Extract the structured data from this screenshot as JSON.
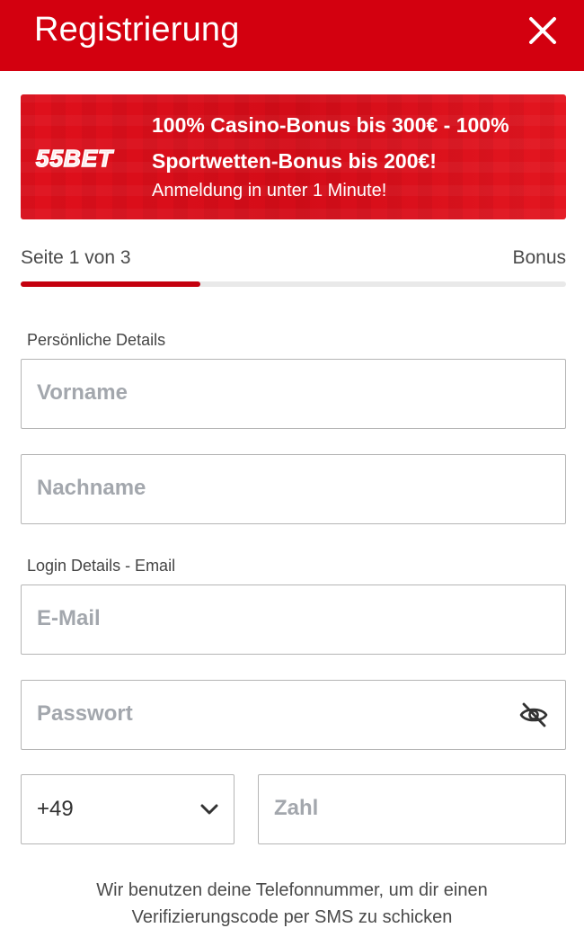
{
  "header": {
    "title": "Registrierung",
    "close_icon": "close-icon",
    "color": "#d3000f"
  },
  "banner": {
    "logo_text": "55BET",
    "headline_line1": "100% Casino-Bonus bis 300€ - 100%",
    "headline_line2": "Sportwetten-Bonus bis 200€!",
    "subline": "Anmeldung in unter 1 Minute!"
  },
  "progress": {
    "step_label": "Seite 1 von 3",
    "next_label": "Bonus",
    "fraction": 0.33,
    "color": "#c4000e"
  },
  "sections": {
    "personal": "Persönliche Details",
    "login": "Login Details - Email"
  },
  "fields": {
    "first_name": {
      "placeholder": "Vorname"
    },
    "last_name": {
      "placeholder": "Nachname"
    },
    "email": {
      "placeholder": "E-Mail"
    },
    "password": {
      "placeholder": "Passwort",
      "toggle_icon": "eye-slash-icon"
    },
    "country_code": {
      "value": "+49",
      "icon": "chevron-down-icon"
    },
    "phone": {
      "placeholder": "Zahl"
    }
  },
  "hint": {
    "line1": "Wir benutzen deine Telefonnummer, um dir einen",
    "line2": "Verifizierungscode per SMS zu schicken"
  }
}
